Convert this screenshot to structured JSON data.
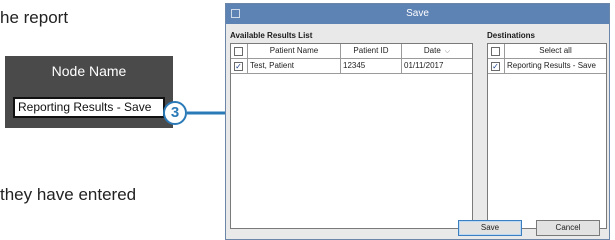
{
  "document": {
    "line1": "he report",
    "line2": "they have entered"
  },
  "node_panel": {
    "header": "Node Name",
    "field_value": "Reporting Results - Save"
  },
  "callout": {
    "number": "3"
  },
  "save_window": {
    "title": "Save",
    "available": {
      "label": "Available Results List",
      "columns": [
        "Patient Name",
        "Patient ID",
        "Date"
      ],
      "rows": [
        {
          "checked": true,
          "name": "Test, Patient",
          "id": "12345",
          "date": "01/11/2017"
        }
      ]
    },
    "destinations": {
      "label": "Destinations",
      "header": "Select all",
      "rows": [
        {
          "checked": true,
          "name": "Reporting Results - Save"
        }
      ]
    },
    "buttons": {
      "save": "Save",
      "cancel": "Cancel"
    }
  },
  "colors": {
    "accent": "#2a7ab8",
    "titlebar": "#5d82b4",
    "panel": "#4a4a4a"
  }
}
